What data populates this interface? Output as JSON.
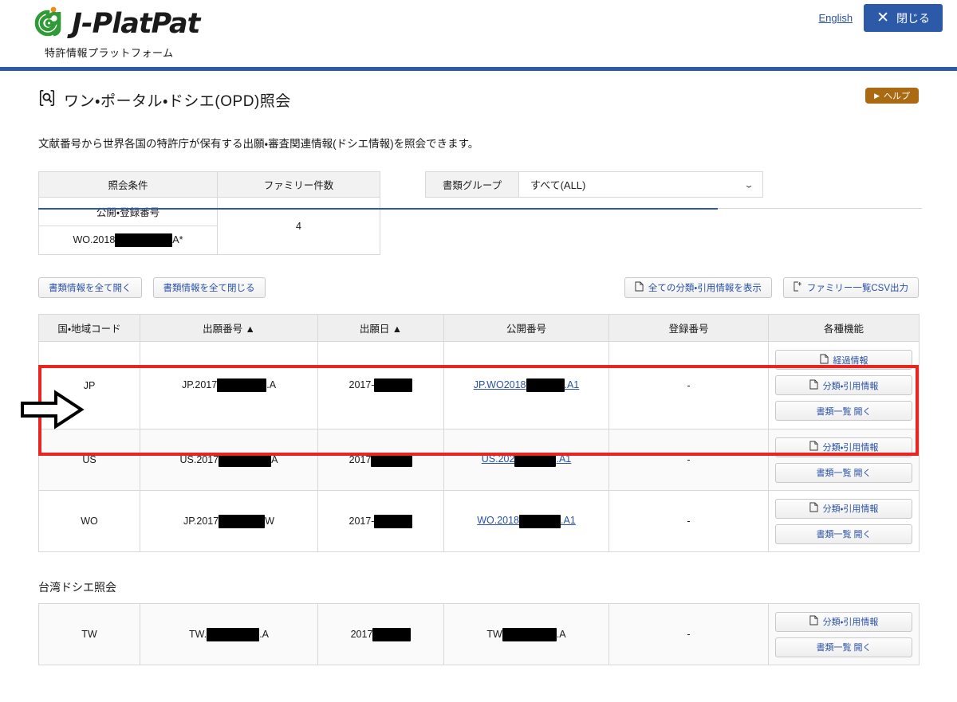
{
  "header": {
    "logo_wordmark": "J-PlatPat",
    "logo_subtitle": "特許情報プラットフォーム",
    "english_link": "English",
    "close_label": "閉じる"
  },
  "page": {
    "title": "ワン・ポータル・ドシエ(OPD)照会",
    "help_label": "ヘルプ",
    "description": "文献番号から世界各国の特許庁が保有する出願・審査関連情報(ドシエ情報)を照会できます。"
  },
  "condition": {
    "header_condition": "照会条件",
    "header_family_count": "ファミリー件数",
    "label_pub_reg_number": "公開・登録番号",
    "value_number_prefix": "WO.2018",
    "value_number_suffix": "A*",
    "family_count": "4"
  },
  "doc_group": {
    "label": "書類グループ",
    "selected": "すべて(ALL)",
    "chevron": "chevron-down"
  },
  "toolbar": {
    "open_all": "書類情報を全て開く",
    "close_all": "書類情報を全て閉じる",
    "show_all_class_citation": "全ての分類・引用情報を表示",
    "export_family_csv": "ファミリー一覧CSV出力"
  },
  "table": {
    "columns": [
      "国・地域コード",
      "出願番号 ▲",
      "出願日 ▲",
      "公開番号",
      "登録番号",
      "各種機能"
    ],
    "rows": [
      {
        "country": "JP",
        "app_no_prefix": "JP.2017",
        "app_no_suffix": ".A",
        "app_date_prefix": "2017-",
        "app_date_suffix": "",
        "pub_no_prefix": "JP.WO2018",
        "pub_no_suffix": ".A1",
        "reg_no": "-",
        "buttons": [
          "経過情報",
          "分類・引用情報",
          "書類一覧 開く"
        ],
        "highlighted": true
      },
      {
        "country": "US",
        "app_no_prefix": "US.2017",
        "app_no_suffix": "A",
        "app_date_prefix": "2017",
        "app_date_suffix": "",
        "pub_no_prefix": "US.202",
        "pub_no_suffix": ".A1",
        "reg_no": "-",
        "buttons": [
          "分類・引用情報",
          "書類一覧 開く"
        ],
        "highlighted": false
      },
      {
        "country": "WO",
        "app_no_prefix": "JP.2017",
        "app_no_suffix": "W",
        "app_date_prefix": "2017-",
        "app_date_suffix": "",
        "pub_no_prefix": "WO.2018",
        "pub_no_suffix": ".A1",
        "reg_no": "-",
        "buttons": [
          "分類・引用情報",
          "書類一覧 開く"
        ],
        "highlighted": false
      }
    ]
  },
  "taiwan": {
    "heading": "台湾ドシエ照会",
    "row": {
      "country": "TW",
      "app_no_prefix": "TW.",
      "app_no_suffix": ".A",
      "app_date_prefix": "2017",
      "pub_no_prefix": "TW",
      "pub_no_suffix": ".A",
      "reg_no": "-",
      "buttons": [
        "分類・引用情報",
        "書類一覧 開く"
      ]
    }
  },
  "annotation": {
    "highlight_color": "#e8251f",
    "arrow_name": "right-arrow-annotation"
  },
  "colors": {
    "brand_blue": "#2d5aa8",
    "link_blue": "#2a51a6",
    "help_brown": "#a96a12",
    "highlight_red": "#e8251f"
  }
}
